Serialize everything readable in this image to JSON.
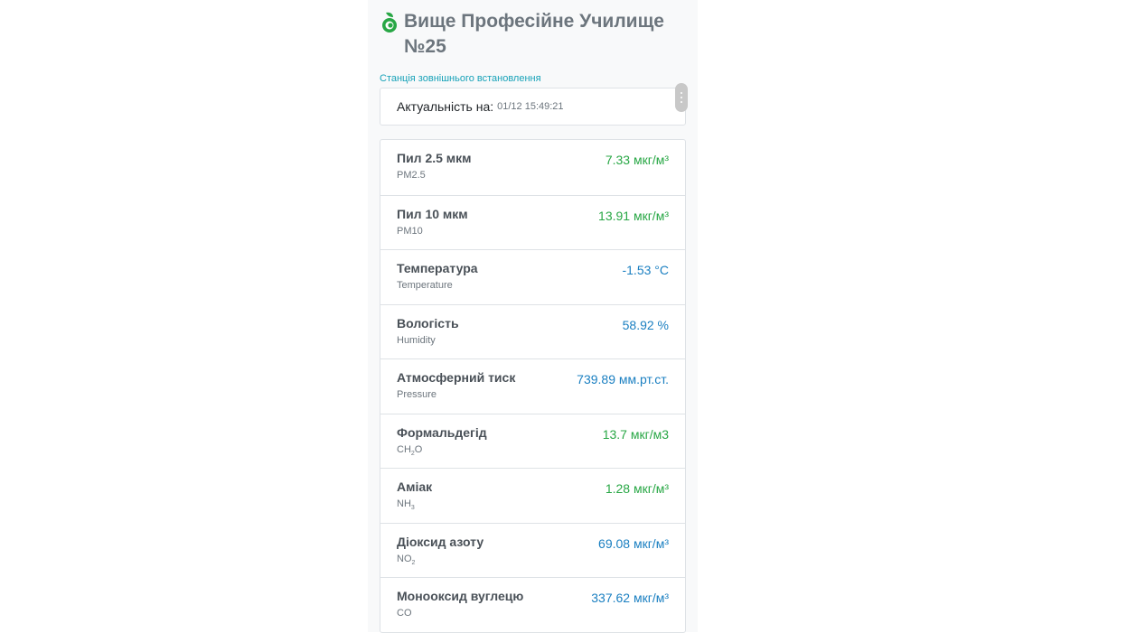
{
  "header": {
    "title": "Вище Професійне Училище №25",
    "subtitle": "Станція зовнішнього встановлення",
    "logo_icon": "leaf-drop-icon"
  },
  "actuality": {
    "label": "Актуальність на:",
    "timestamp": "01/12 15:49:21"
  },
  "colors": {
    "good": "#28a745",
    "info": "#1a7fc1",
    "subtitle": "#17a2b8"
  },
  "measurements": [
    {
      "name": "Пил 2.5 мкм",
      "code": "PM2.5",
      "value": "7.33 мкг/м³",
      "status": "good"
    },
    {
      "name": "Пил 10 мкм",
      "code": "PM10",
      "value": "13.91 мкг/м³",
      "status": "good"
    },
    {
      "name": "Температура",
      "code": "Temperature",
      "value": "-1.53 °C",
      "status": "info"
    },
    {
      "name": "Вологість",
      "code": "Humidity",
      "value": "58.92 %",
      "status": "info"
    },
    {
      "name": "Атмосферний тиск",
      "code": "Pressure",
      "value": "739.89 мм.рт.ст.",
      "status": "info"
    },
    {
      "name": "Формальдегід",
      "code": "CH",
      "code_sub": "2",
      "code_tail": "O",
      "value": "13.7 мкг/м3",
      "status": "good"
    },
    {
      "name": "Аміак",
      "code": "NH",
      "code_sub": "3",
      "code_tail": "",
      "value": "1.28 мкг/м³",
      "status": "good"
    },
    {
      "name": "Діоксид азоту",
      "code": "NO",
      "code_sub": "2",
      "code_tail": "",
      "value": "69.08 мкг/м³",
      "status": "info"
    },
    {
      "name": "Монооксид вуглецю",
      "code": "CO",
      "value": "337.62 мкг/м³",
      "status": "info"
    }
  ]
}
